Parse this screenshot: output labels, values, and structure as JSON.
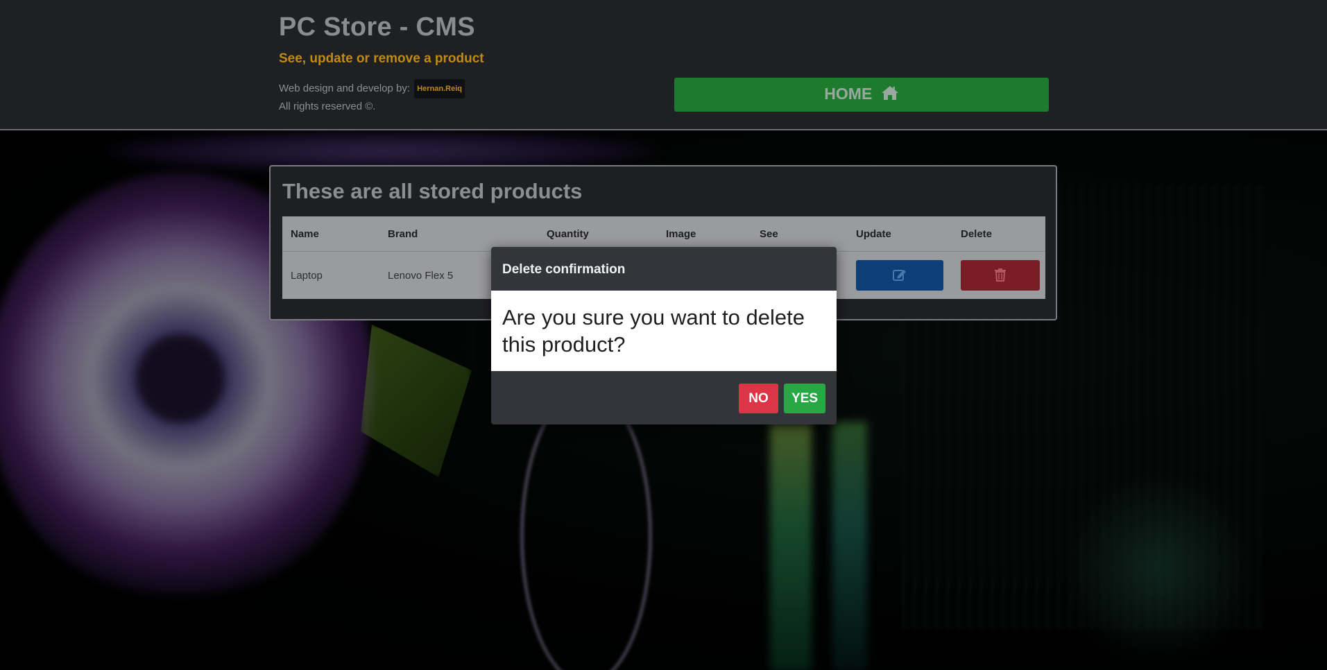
{
  "header": {
    "title": "PC Store - CMS",
    "subtitle": "See, update or remove a product",
    "credit_prefix": "Web design and develop by:",
    "author": "Hernan.Reiq",
    "rights": "All rights reserved ©.",
    "home_label": "HOME",
    "home_icon": "home-icon"
  },
  "products": {
    "heading": "These are all stored products",
    "columns": [
      "Name",
      "Brand",
      "Quantity",
      "Image",
      "See",
      "Update",
      "Delete"
    ],
    "rows": [
      {
        "name": "Laptop",
        "brand": "Lenovo Flex 5",
        "update_icon": "edit-icon",
        "delete_icon": "trash-icon"
      }
    ]
  },
  "modal": {
    "title": "Delete confirmation",
    "question": "Are you sure you want to delete this product?",
    "no_label": "NO",
    "yes_label": "YES"
  },
  "colors": {
    "header_bg": "#1f2024",
    "accent": "#c08a18",
    "home_button": "#1e7a2d",
    "update_button": "#0d3e78",
    "delete_button": "#7c1d26",
    "no_button": "#dc3545",
    "yes_button": "#28a745"
  }
}
